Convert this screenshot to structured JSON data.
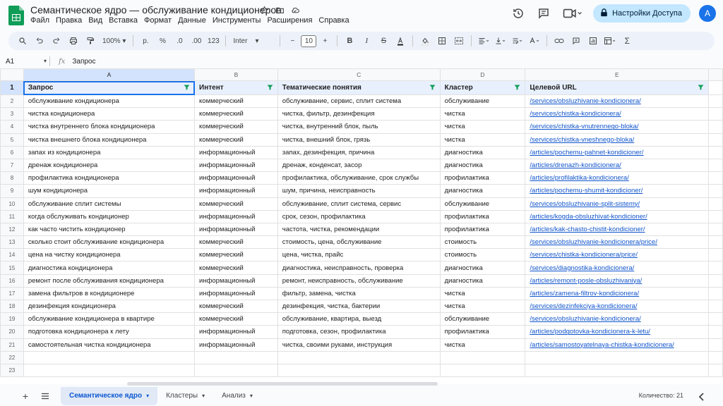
{
  "title": "Семантическое ядро — обслуживание кондиционеров",
  "menu": [
    "Файл",
    "Правка",
    "Вид",
    "Вставка",
    "Формат",
    "Данные",
    "Инструменты",
    "Расширения",
    "Справка"
  ],
  "share_label": "Настройки Доступа",
  "avatar_letter": "A",
  "toolbar": {
    "zoom": "100%",
    "currency": "р.",
    "percent": "%",
    "dec_less": ".0",
    "dec_more": ".00",
    "number_format": "123",
    "font": "Inter",
    "font_size": "10"
  },
  "namebox": "A1",
  "fx": "fx",
  "formula": "Запрос",
  "columns": [
    "A",
    "B",
    "C",
    "D",
    "E"
  ],
  "rows": [
    "1",
    "2",
    "3",
    "4",
    "5",
    "6",
    "7",
    "8",
    "9",
    "10",
    "11",
    "12",
    "13",
    "14",
    "15",
    "16",
    "17",
    "18",
    "19",
    "20",
    "21",
    "22",
    "23"
  ],
  "headers": [
    "Запрос",
    "Интент",
    "Тематические понятия",
    "Кластер",
    "Целевой URL"
  ],
  "data": [
    [
      "обслуживание кондиционера",
      "коммерческий",
      "обслуживание, сервис, сплит система",
      "обслуживание",
      "/services/obsluzhivanie-kondicionera/"
    ],
    [
      "чистка кондиционера",
      "коммерческий",
      "чистка, фильтр, дезинфекция",
      "чистка",
      "/services/chistka-kondicionera/"
    ],
    [
      "чистка внутреннего блока кондиционера",
      "коммерческий",
      "чистка, внутренний блок, пыль",
      "чистка",
      "/services/chistka-vnutrennego-bloka/"
    ],
    [
      "чистка внешнего блока кондиционера",
      "коммерческий",
      "чистка, внешний блок, грязь",
      "чистка",
      "/services/chistka-vneshnego-bloka/"
    ],
    [
      "запах из кондиционера",
      "информационный",
      "запах, дезинфекция, причина",
      "диагностика",
      "/articles/pochemu-pahnet-kondicioner/"
    ],
    [
      "дренаж кондиционера",
      "информационный",
      "дренаж, конденсат, засор",
      "диагностика",
      "/articles/drenazh-kondicionera/"
    ],
    [
      "профилактика кондиционера",
      "информационный",
      "профилактика, обслуживание, срок службы",
      "профилактика",
      "/articles/profilaktika-kondicionera/"
    ],
    [
      "шум кондиционера",
      "информационный",
      "шум, причина, неисправность",
      "диагностика",
      "/articles/pochemu-shumit-kondicioner/"
    ],
    [
      "обслуживание сплит системы",
      "коммерческий",
      "обслуживание, сплит система, сервис",
      "обслуживание",
      "/services/obsluzhivanie-split-sistemy/"
    ],
    [
      "когда обслуживать кондиционер",
      "информационный",
      "срок, сезон, профилактика",
      "профилактика",
      "/articles/kogda-obsluzhivat-kondicioner/"
    ],
    [
      "как часто чистить кондиционер",
      "информационный",
      "частота, чистка, рекомендации",
      "профилактика",
      "/articles/kak-chasto-chistit-kondicioner/"
    ],
    [
      "сколько стоит обслуживание кондиционера",
      "коммерческий",
      "стоимость, цена, обслуживание",
      "стоимость",
      "/services/obsluzhivanie-kondicionera/price/"
    ],
    [
      "цена на чистку кондиционера",
      "коммерческий",
      "цена, чистка, прайс",
      "стоимость",
      "/services/chistka-kondicionera/price/"
    ],
    [
      "диагностика кондиционера",
      "коммерческий",
      "диагностика, неисправность, проверка",
      "диагностика",
      "/services/diagnostika-kondicionera/"
    ],
    [
      "ремонт после обслуживания кондиционера",
      "информационный",
      "ремонт, неисправность, обслуживание",
      "диагностика",
      "/articles/remont-posle-obsluzhivaniya/"
    ],
    [
      "замена фильтров в кондиционере",
      "информационный",
      "фильтр, замена, чистка",
      "чистка",
      "/articles/zamena-filtrov-kondicionera/"
    ],
    [
      "дезинфекция кондиционера",
      "коммерческий",
      "дезинфекция, чистка, бактерии",
      "чистка",
      "/services/dezinfekciya-kondicionera/"
    ],
    [
      "обслуживание кондиционера в квартире",
      "коммерческий",
      "обслуживание, квартира, выезд",
      "обслуживание",
      "/services/obsluzhivanie-kondicionera/"
    ],
    [
      "подготовка кондиционера к лету",
      "информационный",
      "подготовка, сезон, профилактика",
      "профилактика",
      "/articles/podgotovka-kondicionera-k-letu/"
    ],
    [
      "самостоятельная чистка кондиционера",
      "информационный",
      "чистка, своими руками, инструкция",
      "чистка",
      "/articles/samostoyatelnaya-chistka-kondicionera/"
    ]
  ],
  "sheets": [
    "Семантическое ядро",
    "Кластеры",
    "Анализ"
  ],
  "count_label": "Количество: 21",
  "colors": {
    "accent": "#1a73e8",
    "link": "#1155cc",
    "header_bg": "#e8f0fe",
    "share_bg": "#c2e7ff",
    "logo_green": "#0f9d58"
  }
}
